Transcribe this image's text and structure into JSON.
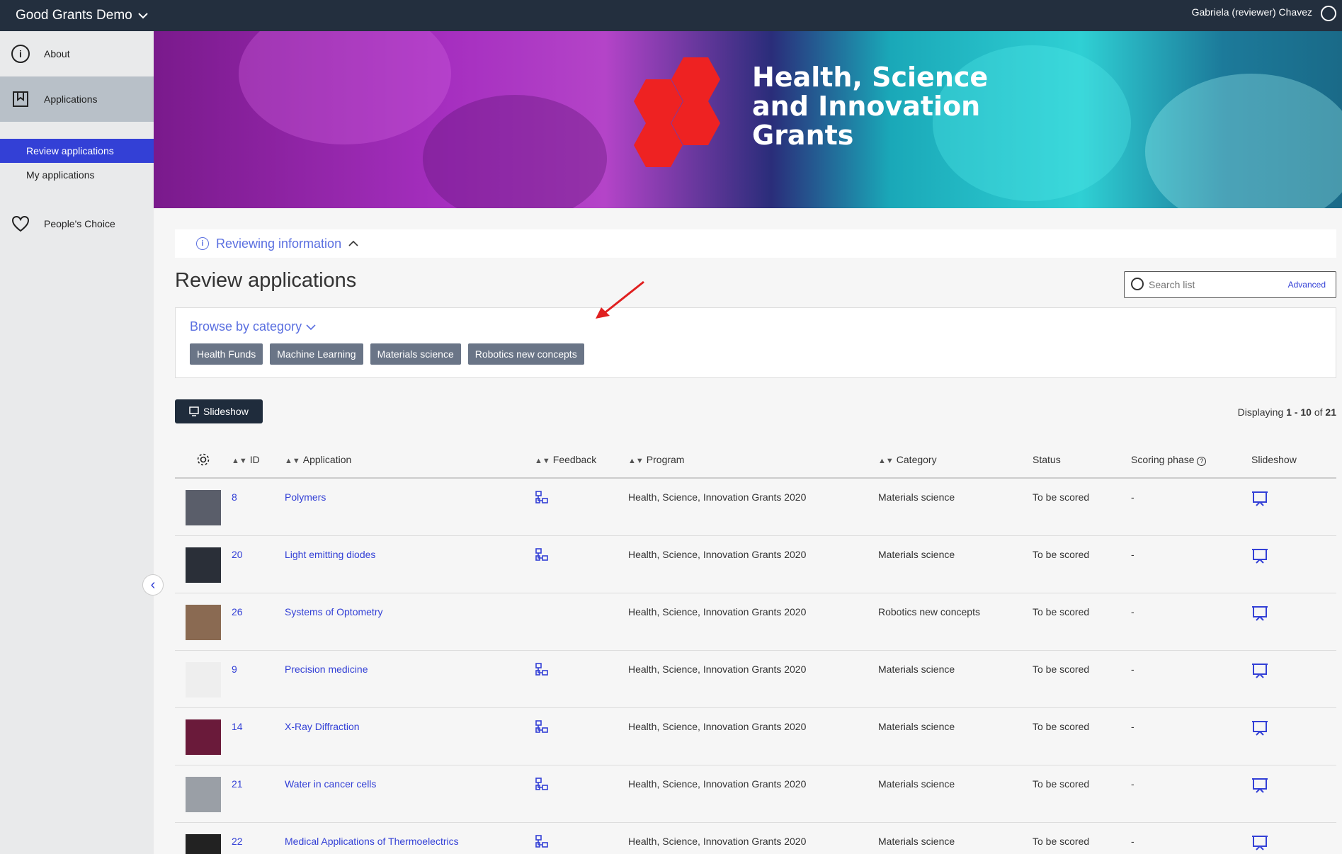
{
  "header": {
    "app_title": "Good Grants Demo",
    "user": "Gabriela (reviewer) Chavez"
  },
  "sidebar": {
    "items": [
      {
        "label": "About"
      },
      {
        "label": "Applications"
      },
      {
        "label": "People's Choice"
      }
    ],
    "subitems": [
      {
        "label": "Review applications"
      },
      {
        "label": "My applications"
      }
    ]
  },
  "banner": {
    "title_line1": "Health, Science",
    "title_line2": "and Innovation",
    "title_line3": "Grants"
  },
  "info": {
    "label": "Reviewing information"
  },
  "page": {
    "title": "Review applications"
  },
  "search": {
    "placeholder": "Search list",
    "advanced": "Advanced"
  },
  "browse": {
    "label": "Browse by category",
    "chips": [
      "Health Funds",
      "Machine Learning",
      "Materials science",
      "Robotics new concepts"
    ]
  },
  "toolbar": {
    "slideshow": "Slideshow"
  },
  "pagination": {
    "prefix": "Displaying",
    "range": "1 - 10",
    "of": "of",
    "total": "21"
  },
  "table": {
    "headers": {
      "id": "ID",
      "application": "Application",
      "feedback": "Feedback",
      "program": "Program",
      "category": "Category",
      "status": "Status",
      "phase": "Scoring phase",
      "slideshow": "Slideshow"
    },
    "rows": [
      {
        "id": "8",
        "application": "Polymers",
        "feedback": true,
        "program": "Health, Science, Innovation Grants 2020",
        "category": "Materials science",
        "status": "To be scored",
        "phase": "-",
        "thumb": "#5a5e6a"
      },
      {
        "id": "20",
        "application": "Light emitting diodes",
        "feedback": true,
        "program": "Health, Science, Innovation Grants 2020",
        "category": "Materials science",
        "status": "To be scored",
        "phase": "-",
        "thumb": "#2a2f38"
      },
      {
        "id": "26",
        "application": "Systems of Optometry",
        "feedback": false,
        "program": "Health, Science, Innovation Grants 2020",
        "category": "Robotics new concepts",
        "status": "To be scored",
        "phase": "-",
        "thumb": "#8a6a52"
      },
      {
        "id": "9",
        "application": "Precision medicine",
        "feedback": true,
        "program": "Health, Science, Innovation Grants 2020",
        "category": "Materials science",
        "status": "To be scored",
        "phase": "-",
        "thumb": "#eeeeee"
      },
      {
        "id": "14",
        "application": "X-Ray Diffraction",
        "feedback": true,
        "program": "Health, Science, Innovation Grants 2020",
        "category": "Materials science",
        "status": "To be scored",
        "phase": "-",
        "thumb": "#6a1a3a"
      },
      {
        "id": "21",
        "application": "Water in cancer cells",
        "feedback": true,
        "program": "Health, Science, Innovation Grants 2020",
        "category": "Materials science",
        "status": "To be scored",
        "phase": "-",
        "thumb": "#9a9fa6"
      },
      {
        "id": "22",
        "application": "Medical Applications of Thermoelectrics",
        "feedback": true,
        "program": "Health, Science, Innovation Grants 2020",
        "category": "Materials science",
        "status": "To be scored",
        "phase": "-",
        "thumb": "#222222"
      }
    ]
  },
  "colors": {
    "accent": "#3340d6",
    "topbar": "#232f3e",
    "chip": "#6a7587"
  }
}
